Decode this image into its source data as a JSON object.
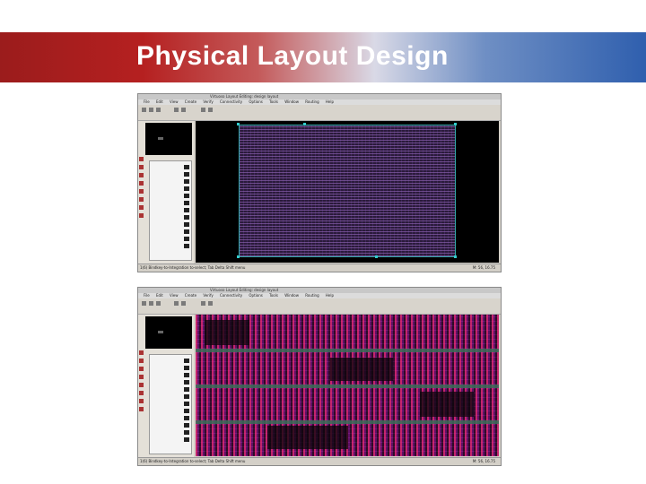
{
  "slide": {
    "title": "Physical Layout Design"
  },
  "screenshots": [
    {
      "window_title": "Virtuoso Layout Editing: design layout",
      "menus": [
        "File",
        "Edit",
        "View",
        "Create",
        "Verify",
        "Connectivity",
        "Options",
        "Tools",
        "Window",
        "Routing",
        "Help"
      ],
      "status_left": "1(6) Bindkey-to-Integration to-select; Tab Delta Shift menu",
      "status_right": "M: 56, 16.75"
    },
    {
      "window_title": "Virtuoso Layout Editing: design layout",
      "menus": [
        "File",
        "Edit",
        "View",
        "Create",
        "Verify",
        "Connectivity",
        "Options",
        "Tools",
        "Window",
        "Routing",
        "Help"
      ],
      "status_left": "1(6) Bindkey-to-Integration to-select; Tab Delta Shift menu",
      "status_right": "M: 56, 16.75"
    }
  ],
  "colors": {
    "banner_left": "#9b1c1c",
    "banner_right": "#2f5fae",
    "canvas_bg": "#000000",
    "cells": "#a06ec8",
    "routing": "#dc2878"
  }
}
